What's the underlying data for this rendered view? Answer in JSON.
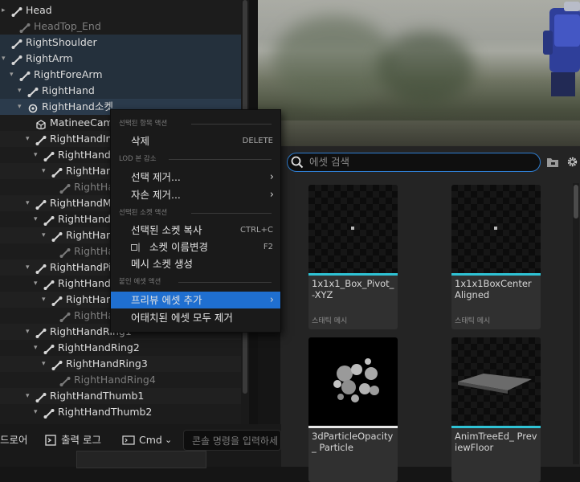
{
  "tree": {
    "rows": [
      {
        "label": "Head",
        "icon": "bone-icon",
        "arrow": "▸",
        "style": "plain"
      },
      {
        "label": "HeadTop_End",
        "icon": "bone-icon",
        "arrow": "",
        "style": "dim"
      },
      {
        "label": "RightShoulder",
        "icon": "bone-icon",
        "arrow": "",
        "style": "chain"
      },
      {
        "label": "RightArm",
        "icon": "bone-icon",
        "arrow": "▾",
        "style": "chain"
      },
      {
        "label": "RightForeArm",
        "icon": "bone-icon",
        "arrow": "▾",
        "style": "chain"
      },
      {
        "label": "RightHand",
        "icon": "bone-icon",
        "arrow": "▾",
        "style": "chain"
      },
      {
        "label": "RightHand소켓",
        "icon": "socket-icon",
        "arrow": "▾",
        "style": "sel"
      },
      {
        "label": "MatineeCam_",
        "icon": "mesh-icon",
        "arrow": "",
        "style": "plain"
      },
      {
        "label": "RightHandInde",
        "icon": "bone-icon",
        "arrow": "▾",
        "style": "alt"
      },
      {
        "label": "RightHandInd",
        "icon": "bone-icon",
        "arrow": "▾",
        "style": "plain"
      },
      {
        "label": "RightHandI",
        "icon": "bone-icon",
        "arrow": "▾",
        "style": "alt"
      },
      {
        "label": "RightHand",
        "icon": "bone-icon",
        "arrow": "",
        "style": "dim"
      },
      {
        "label": "RightHandMidd",
        "icon": "bone-icon",
        "arrow": "▾",
        "style": "alt"
      },
      {
        "label": "RightHandMi",
        "icon": "bone-icon",
        "arrow": "▾",
        "style": "plain"
      },
      {
        "label": "RightHandM",
        "icon": "bone-icon",
        "arrow": "▾",
        "style": "alt"
      },
      {
        "label": "RightHand",
        "icon": "bone-icon",
        "arrow": "",
        "style": "dim"
      },
      {
        "label": "RightHandPink",
        "icon": "bone-icon",
        "arrow": "▾",
        "style": "alt"
      },
      {
        "label": "RightHandPir",
        "icon": "bone-icon",
        "arrow": "▾",
        "style": "plain"
      },
      {
        "label": "RightHandP",
        "icon": "bone-icon",
        "arrow": "▾",
        "style": "alt"
      },
      {
        "label": "RightHand",
        "icon": "bone-icon",
        "arrow": "",
        "style": "dim"
      },
      {
        "label": "RightHandRing1",
        "icon": "bone-icon",
        "arrow": "▾",
        "style": "alt"
      },
      {
        "label": "RightHandRing2",
        "icon": "bone-icon",
        "arrow": "▾",
        "style": "plain"
      },
      {
        "label": "RightHandRing3",
        "icon": "bone-icon",
        "arrow": "▾",
        "style": "alt"
      },
      {
        "label": "RightHandRing4",
        "icon": "bone-icon",
        "arrow": "",
        "style": "dim"
      },
      {
        "label": "RightHandThumb1",
        "icon": "bone-icon",
        "arrow": "▾",
        "style": "alt"
      },
      {
        "label": "RightHandThumb2",
        "icon": "bone-icon",
        "arrow": "▾",
        "style": "plain"
      }
    ]
  },
  "bottombar": {
    "drawer_label": "드로어",
    "output_log_label": "출력 로그",
    "cmd_label": "Cmd",
    "console_placeholder": "콘솔 명령을 입력하세"
  },
  "context_menu": {
    "section1": "선택된 항목 액션",
    "delete_label": "삭제",
    "delete_shortcut": "DELETE",
    "section2": "LOD 본 감소",
    "remove_selected_label": "선택 제거...",
    "remove_children_label": "자손 제거...",
    "section3": "선택된 소켓 액션",
    "copy_socket_label": "선택된 소켓 복사",
    "copy_socket_shortcut": "CTRL+C",
    "rename_socket_label": "소켓 이름변경",
    "rename_socket_shortcut": "F2",
    "create_mesh_socket_label": "메시 소켓 생성",
    "section4": "붙인 에셋 액션",
    "add_preview_asset_label": "프리뷰 에셋 추가",
    "remove_all_attached_label": "어태치된 에셋 모두 제거"
  },
  "content_browser": {
    "search_placeholder": "에셋 검색",
    "assets": [
      {
        "name": "1x1x1_Box_Pivot_-XYZ",
        "type": "스태틱 메시",
        "thumb": "dot"
      },
      {
        "name": "1x1x1BoxCenter Aligned",
        "type": "스태틱 메시",
        "thumb": "dot"
      },
      {
        "name": "3dParticleOpacity_ Particle",
        "type": "",
        "thumb": "particles"
      },
      {
        "name": "AnimTreeEd_ PreviewFloor",
        "type": "",
        "thumb": "floor"
      }
    ]
  },
  "colors": {
    "highlight": "#1f6fd0",
    "search_border": "#2f7fd3",
    "asset_bar": "#2fc2d4"
  }
}
